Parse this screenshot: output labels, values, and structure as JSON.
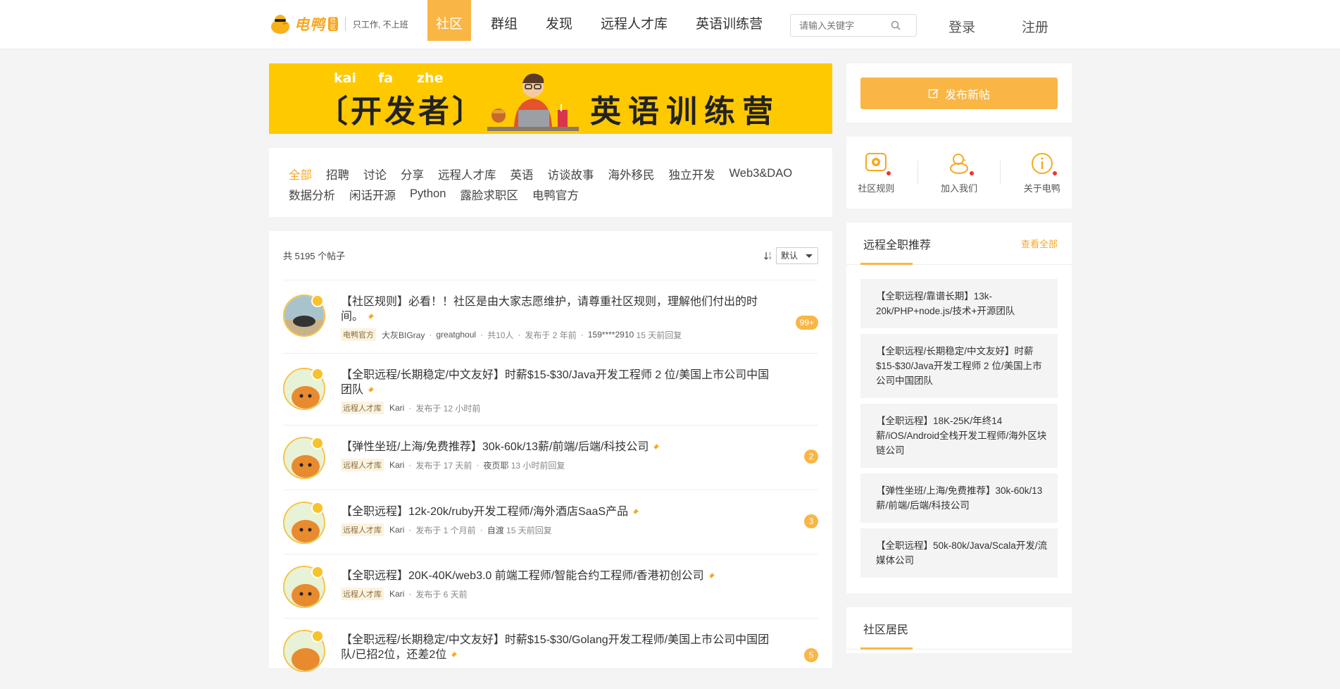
{
  "header": {
    "logo_text": "电鸭",
    "logo_badge": "社区",
    "slogan": "只工作, 不上班",
    "nav": [
      "社区",
      "群组",
      "发现",
      "远程人才库",
      "英语训练营"
    ],
    "search_placeholder": "请输入关键字",
    "login": "登录",
    "register": "注册"
  },
  "banner": {
    "title": "〔开发者〕",
    "pinyin": [
      "kai",
      "fa",
      "zhe"
    ],
    "subtitle": "英语训练营"
  },
  "categories": {
    "row1": [
      "全部",
      "招聘",
      "讨论",
      "分享",
      "远程人才库",
      "英语",
      "访谈故事",
      "海外移民",
      "独立开发",
      "Web3&DAO"
    ],
    "row2": [
      "数据分析",
      "闲话开源",
      "Python",
      "露脸求职区",
      "电鸭官方"
    ]
  },
  "posts": {
    "count_text": "共 5195 个帖子",
    "sort_value": "默认",
    "items": [
      {
        "title": "【社区规则】必看！！社区是由大家志愿维护，请尊重社区规则，理解他们付出的时间。",
        "tag": "电鸭官方",
        "author": "大灰BIGray",
        "extra": "greatghoul",
        "people": "共10人",
        "time": "发布于 2 年前",
        "last_user": "159****2910",
        "last_time": "15 天前回复",
        "replies": "99+"
      },
      {
        "title": "【全职远程/长期稳定/中文友好】时薪$15-$30/Java开发工程师 2 位/美国上市公司中国团队",
        "tag": "远程人才库",
        "author": "Kari",
        "time": "发布于 12 小时前"
      },
      {
        "title": "【弹性坐班/上海/免费推荐】30k-60k/13薪/前端/后端/科技公司",
        "tag": "远程人才库",
        "author": "Kari",
        "time": "发布于 17 天前",
        "last_user": "夜页耶",
        "last_time": "13 小时前回复",
        "replies": "2"
      },
      {
        "title": "【全职远程】12k-20k/ruby开发工程师/海外酒店SaaS产品",
        "tag": "远程人才库",
        "author": "Kari",
        "time": "发布于 1 个月前",
        "last_user": "自渡",
        "last_time": "15 天前回复",
        "replies": "3"
      },
      {
        "title": "【全职远程】20K-40K/web3.0 前端工程师/智能合约工程师/香港初创公司",
        "tag": "远程人才库",
        "author": "Kari",
        "time": "发布于 6 天前"
      },
      {
        "title": "【全职远程/长期稳定/中文友好】时薪$15-$30/Golang开发工程师/美国上市公司中国团队/已招2位，还差2位",
        "replies": "5"
      }
    ]
  },
  "sidebar": {
    "publish": "发布新帖",
    "quick_links": [
      "社区规则",
      "加入我们",
      "关于电鸭"
    ],
    "jobs_title": "远程全职推荐",
    "jobs_more": "查看全部",
    "jobs": [
      "【全职远程/靠谱长期】13k-20k/PHP+node.js/技术+开源团队",
      "【全职远程/长期稳定/中文友好】时薪$15-$30/Java开发工程师 2 位/美国上市公司中国团队",
      "【全职远程】18K-25K/年终14薪/iOS/Android全栈开发工程师/海外区块链公司",
      "【弹性坐班/上海/免费推荐】30k-60k/13薪/前端/后端/科技公司",
      "【全职远程】50k-80k/Java/Scala开发/流媒体公司"
    ],
    "residents_title": "社区居民"
  },
  "colors": {
    "accent": "#f9b645",
    "banner": "#ffc900",
    "link": "#f7a823"
  }
}
